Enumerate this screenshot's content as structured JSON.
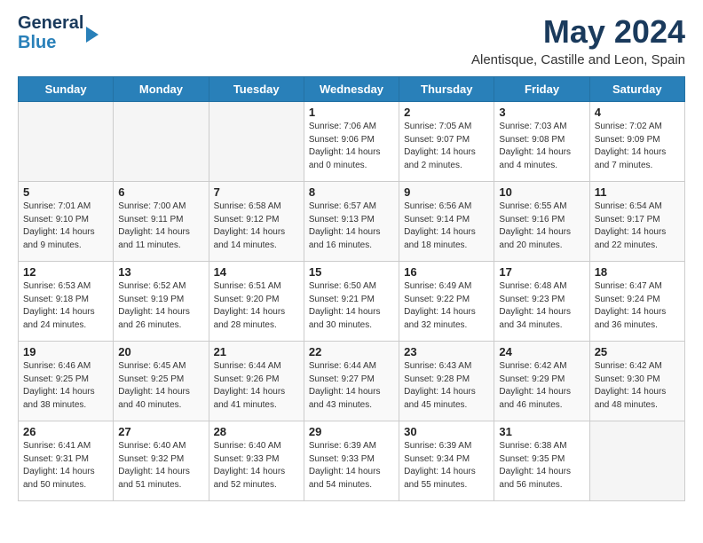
{
  "header": {
    "logo_line1": "General",
    "logo_line2": "Blue",
    "month_title": "May 2024",
    "location": "Alentisque, Castille and Leon, Spain"
  },
  "weekdays": [
    "Sunday",
    "Monday",
    "Tuesday",
    "Wednesday",
    "Thursday",
    "Friday",
    "Saturday"
  ],
  "weeks": [
    [
      {
        "day": "",
        "info": ""
      },
      {
        "day": "",
        "info": ""
      },
      {
        "day": "",
        "info": ""
      },
      {
        "day": "1",
        "info": "Sunrise: 7:06 AM\nSunset: 9:06 PM\nDaylight: 14 hours\nand 0 minutes."
      },
      {
        "day": "2",
        "info": "Sunrise: 7:05 AM\nSunset: 9:07 PM\nDaylight: 14 hours\nand 2 minutes."
      },
      {
        "day": "3",
        "info": "Sunrise: 7:03 AM\nSunset: 9:08 PM\nDaylight: 14 hours\nand 4 minutes."
      },
      {
        "day": "4",
        "info": "Sunrise: 7:02 AM\nSunset: 9:09 PM\nDaylight: 14 hours\nand 7 minutes."
      }
    ],
    [
      {
        "day": "5",
        "info": "Sunrise: 7:01 AM\nSunset: 9:10 PM\nDaylight: 14 hours\nand 9 minutes."
      },
      {
        "day": "6",
        "info": "Sunrise: 7:00 AM\nSunset: 9:11 PM\nDaylight: 14 hours\nand 11 minutes."
      },
      {
        "day": "7",
        "info": "Sunrise: 6:58 AM\nSunset: 9:12 PM\nDaylight: 14 hours\nand 14 minutes."
      },
      {
        "day": "8",
        "info": "Sunrise: 6:57 AM\nSunset: 9:13 PM\nDaylight: 14 hours\nand 16 minutes."
      },
      {
        "day": "9",
        "info": "Sunrise: 6:56 AM\nSunset: 9:14 PM\nDaylight: 14 hours\nand 18 minutes."
      },
      {
        "day": "10",
        "info": "Sunrise: 6:55 AM\nSunset: 9:16 PM\nDaylight: 14 hours\nand 20 minutes."
      },
      {
        "day": "11",
        "info": "Sunrise: 6:54 AM\nSunset: 9:17 PM\nDaylight: 14 hours\nand 22 minutes."
      }
    ],
    [
      {
        "day": "12",
        "info": "Sunrise: 6:53 AM\nSunset: 9:18 PM\nDaylight: 14 hours\nand 24 minutes."
      },
      {
        "day": "13",
        "info": "Sunrise: 6:52 AM\nSunset: 9:19 PM\nDaylight: 14 hours\nand 26 minutes."
      },
      {
        "day": "14",
        "info": "Sunrise: 6:51 AM\nSunset: 9:20 PM\nDaylight: 14 hours\nand 28 minutes."
      },
      {
        "day": "15",
        "info": "Sunrise: 6:50 AM\nSunset: 9:21 PM\nDaylight: 14 hours\nand 30 minutes."
      },
      {
        "day": "16",
        "info": "Sunrise: 6:49 AM\nSunset: 9:22 PM\nDaylight: 14 hours\nand 32 minutes."
      },
      {
        "day": "17",
        "info": "Sunrise: 6:48 AM\nSunset: 9:23 PM\nDaylight: 14 hours\nand 34 minutes."
      },
      {
        "day": "18",
        "info": "Sunrise: 6:47 AM\nSunset: 9:24 PM\nDaylight: 14 hours\nand 36 minutes."
      }
    ],
    [
      {
        "day": "19",
        "info": "Sunrise: 6:46 AM\nSunset: 9:25 PM\nDaylight: 14 hours\nand 38 minutes."
      },
      {
        "day": "20",
        "info": "Sunrise: 6:45 AM\nSunset: 9:25 PM\nDaylight: 14 hours\nand 40 minutes."
      },
      {
        "day": "21",
        "info": "Sunrise: 6:44 AM\nSunset: 9:26 PM\nDaylight: 14 hours\nand 41 minutes."
      },
      {
        "day": "22",
        "info": "Sunrise: 6:44 AM\nSunset: 9:27 PM\nDaylight: 14 hours\nand 43 minutes."
      },
      {
        "day": "23",
        "info": "Sunrise: 6:43 AM\nSunset: 9:28 PM\nDaylight: 14 hours\nand 45 minutes."
      },
      {
        "day": "24",
        "info": "Sunrise: 6:42 AM\nSunset: 9:29 PM\nDaylight: 14 hours\nand 46 minutes."
      },
      {
        "day": "25",
        "info": "Sunrise: 6:42 AM\nSunset: 9:30 PM\nDaylight: 14 hours\nand 48 minutes."
      }
    ],
    [
      {
        "day": "26",
        "info": "Sunrise: 6:41 AM\nSunset: 9:31 PM\nDaylight: 14 hours\nand 50 minutes."
      },
      {
        "day": "27",
        "info": "Sunrise: 6:40 AM\nSunset: 9:32 PM\nDaylight: 14 hours\nand 51 minutes."
      },
      {
        "day": "28",
        "info": "Sunrise: 6:40 AM\nSunset: 9:33 PM\nDaylight: 14 hours\nand 52 minutes."
      },
      {
        "day": "29",
        "info": "Sunrise: 6:39 AM\nSunset: 9:33 PM\nDaylight: 14 hours\nand 54 minutes."
      },
      {
        "day": "30",
        "info": "Sunrise: 6:39 AM\nSunset: 9:34 PM\nDaylight: 14 hours\nand 55 minutes."
      },
      {
        "day": "31",
        "info": "Sunrise: 6:38 AM\nSunset: 9:35 PM\nDaylight: 14 hours\nand 56 minutes."
      },
      {
        "day": "",
        "info": ""
      }
    ]
  ]
}
